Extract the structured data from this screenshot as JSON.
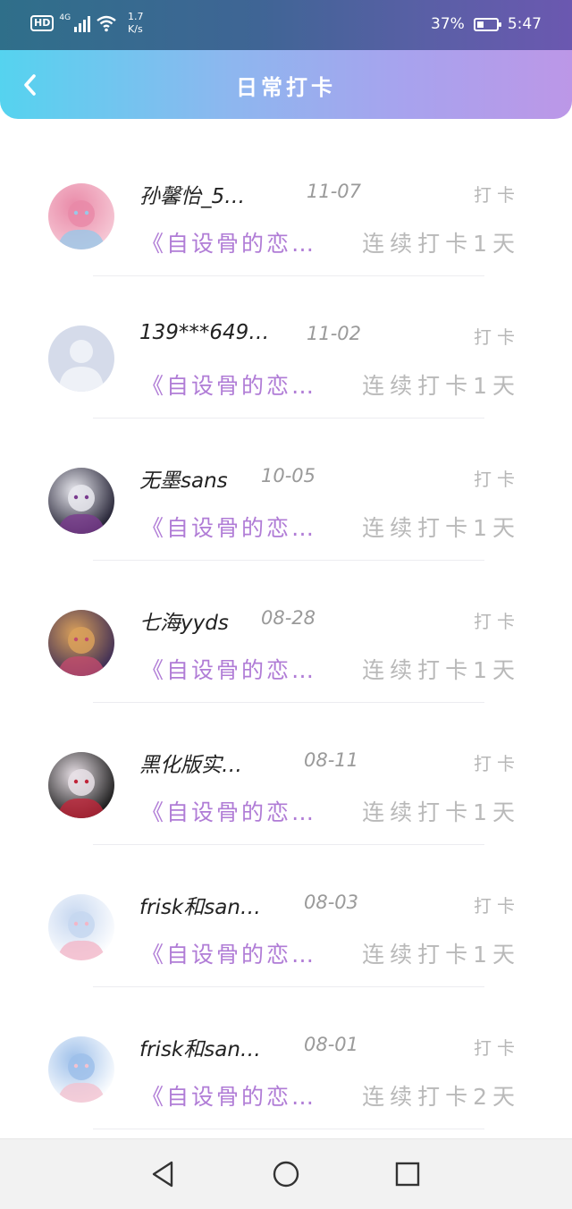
{
  "status_bar": {
    "hd": "HD",
    "network": "4G",
    "speed_value": "1.7",
    "speed_unit": "K/s",
    "battery_percent": "37%",
    "battery_level": 0.37,
    "time": "5:47"
  },
  "header": {
    "title": "日常打卡",
    "back_icon": "chevron-left-icon"
  },
  "items": [
    {
      "name": "孙馨怡_5…",
      "date": "11-07",
      "tag": "打卡",
      "book": "《自设骨的恋…",
      "streak": "连续打卡1天",
      "avatar": "pink-haired-anime-girl",
      "avatar_colors": [
        "#f6c9d6",
        "#e98aa8",
        "#9ac8e8"
      ]
    },
    {
      "name": "139***649…",
      "date": "11-02",
      "tag": "打卡",
      "book": "《自设骨的恋…",
      "streak": "连续打卡1天",
      "avatar": "default-user-silhouette",
      "avatar_colors": [
        "#d5dbea",
        "#b9c2dc",
        "#eef1f7"
      ]
    },
    {
      "name": "无墨sans",
      "date": "10-05",
      "tag": "打卡",
      "book": "《自设骨的恋…",
      "streak": "连续打卡1天",
      "avatar": "sans-skeleton-dark",
      "avatar_colors": [
        "#1d1b2e",
        "#e9e9ef",
        "#7a3b8f"
      ]
    },
    {
      "name": "七海yyds",
      "date": "08-28",
      "tag": "打卡",
      "book": "《自设骨的恋…",
      "streak": "连续打卡1天",
      "avatar": "anime-couple-colorful",
      "avatar_colors": [
        "#3a2a55",
        "#d9a05b",
        "#c24b6e"
      ]
    },
    {
      "name": "黑化版实…",
      "date": "08-11",
      "tag": "打卡",
      "book": "《自设骨的恋…",
      "streak": "连续打卡1天",
      "avatar": "dark-haired-anime-red-eyes",
      "avatar_colors": [
        "#141414",
        "#e8e0e6",
        "#c0253a"
      ]
    },
    {
      "name": "frisk和san…",
      "date": "08-03",
      "tag": "打卡",
      "book": "《自设骨的恋…",
      "streak": "连续打卡1天",
      "avatar": "sans-chibi-white",
      "avatar_colors": [
        "#ffffff",
        "#c6d7f0",
        "#f2b6c8"
      ]
    },
    {
      "name": "frisk和san…",
      "date": "08-01",
      "tag": "打卡",
      "book": "《自设骨的恋…",
      "streak": "连续打卡2天",
      "avatar": "sans-chibi-blue",
      "avatar_colors": [
        "#ffffff",
        "#9ec0ea",
        "#f3c2d0"
      ]
    }
  ],
  "nav": {
    "back": "triangle-back-icon",
    "home": "circle-home-icon",
    "recents": "square-recents-icon"
  }
}
